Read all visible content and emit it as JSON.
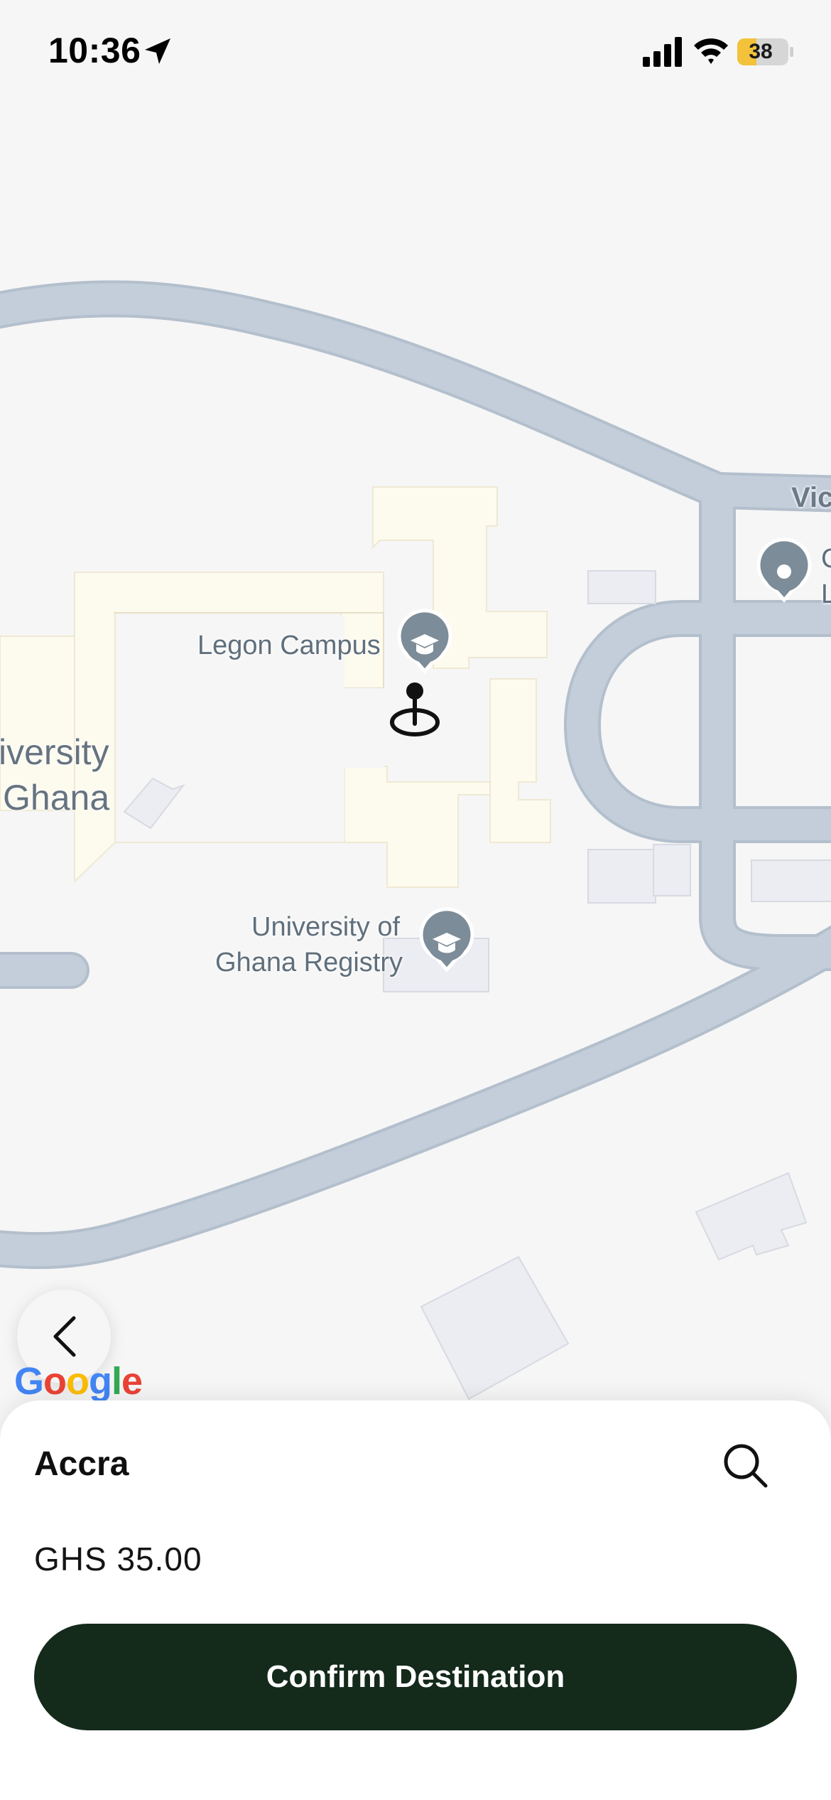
{
  "status_bar": {
    "time": "10:36",
    "battery_level": "38",
    "battery_fraction": 0.38,
    "icons": [
      "location-arrow-icon",
      "cellular-signal-icon",
      "wifi-icon",
      "battery-icon"
    ]
  },
  "map": {
    "labels": {
      "road_partial": "Vic",
      "campus_left_line1": "iversity",
      "campus_left_line2": "Ghana",
      "legon_campus": "Legon Campus",
      "registry_line1": "University of",
      "registry_line2": "Ghana Registry",
      "poi_right_line1": "C",
      "poi_right_line2": "L"
    },
    "attribution": "Google",
    "colors": {
      "background": "#f6f6f6",
      "road": "#c3ceda",
      "road_edge": "#b3bfcc",
      "building_yellow": "#fdfaee",
      "building_gray": "#ecedf2",
      "poi_marker": "#7c8c98"
    },
    "icons": [
      "graduation-cap-icon",
      "place-pin-icon",
      "destination-pin-icon"
    ]
  },
  "bottom_sheet": {
    "destination_city": "Accra",
    "price": "GHS 35.00",
    "confirm_label": "Confirm Destination",
    "accent_color": "#142a1b"
  }
}
